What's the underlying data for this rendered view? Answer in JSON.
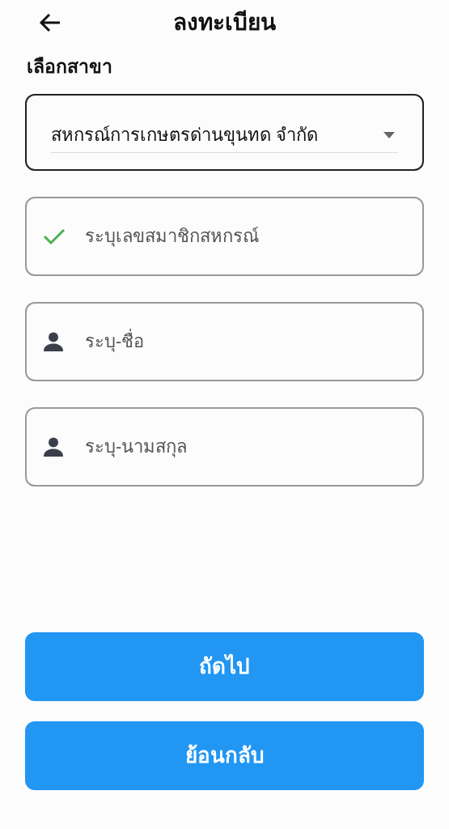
{
  "header": {
    "title": "ลงทะเบียน"
  },
  "branch": {
    "label": "เลือกสาขา",
    "value": "สหกรณ์การเกษตรด่านขุนทด จำกัด"
  },
  "fields": [
    {
      "kind": "check",
      "placeholder": "ระบุเลขสมาชิกสหกรณ์"
    },
    {
      "kind": "person",
      "placeholder": "ระบุ-ชื่อ"
    },
    {
      "kind": "person",
      "placeholder": "ระบุ-นามสกุล"
    }
  ],
  "buttons": [
    "ถัดไป",
    "ย้อนกลับ"
  ]
}
